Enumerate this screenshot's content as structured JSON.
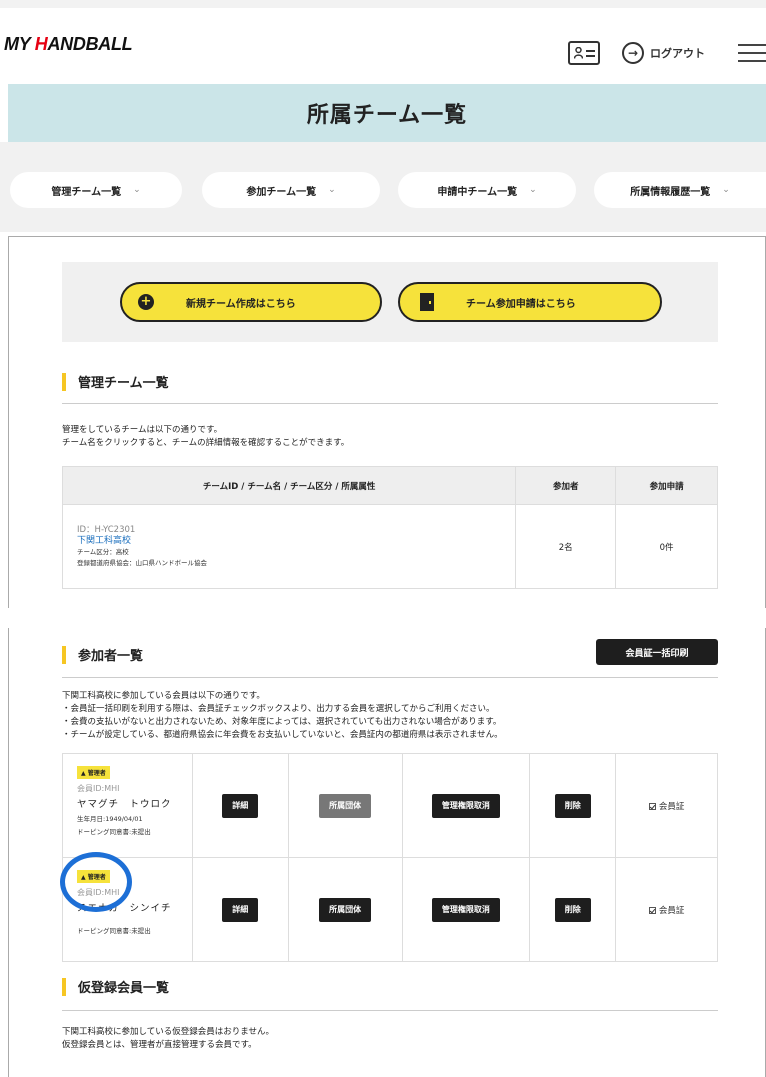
{
  "header": {
    "logo_prefix": "MY ",
    "logo_h": "H",
    "logo_rest": "ANDBALL",
    "logout_label": "ログアウト",
    "logout_arrow": "→"
  },
  "page_title": "所属チーム一覧",
  "tabs": [
    {
      "label": "管理チーム一覧",
      "chevron": "⌄"
    },
    {
      "label": "参加チーム一覧",
      "chevron": "⌄"
    },
    {
      "label": "申請中チーム一覧",
      "chevron": "⌄"
    },
    {
      "label": "所属情報履歴一覧",
      "chevron": "⌄"
    }
  ],
  "actions": {
    "create_team": "新規チーム作成はこちら",
    "create_icon": "+",
    "join_team": "チーム参加申請はこちら"
  },
  "managed": {
    "heading": "管理チーム一覧",
    "desc1": "管理をしているチームは以下の通りです。",
    "desc2": "チーム名をクリックすると、チームの詳細情報を確認することができます。",
    "col_team": "チームID / チーム名 / チーム区分 / 所属属性",
    "col_members": "参加者",
    "col_requests": "参加申請",
    "row": {
      "id": "ID：H-YC2301",
      "name": "下関工科高校",
      "category": "チーム区分：高校",
      "association": "登録都道府県協会：山口県ハンドボール協会",
      "members": "2名",
      "requests": "0件"
    }
  },
  "participants": {
    "heading": "参加者一覧",
    "print_btn": "会員証一括印刷",
    "desc1": "下関工科高校に参加している会員は以下の通りです。",
    "desc2": "・会員証一括印刷を利用する際は、会員証チェックボックスより、出力する会員を選択してからご利用ください。",
    "desc3": "・会費の支払いがないと出力されないため、対象年度によっては、選択されていても出力されない場合があります。",
    "desc4": "・チームが設定している、都道府県協会に年会費をお支払いしていないと、会員証内の都道府県は表示されません。",
    "members": [
      {
        "badge": "管理者",
        "id": "会員ID:MHI",
        "name": "ヤマグチ　トウロク",
        "birth": "生年月日:1949/04/01",
        "doping": "ドーピング同意書:未提出",
        "btn_detail": "詳細",
        "btn_group": "所属団体",
        "btn_admin": "管理権限取消",
        "btn_delete": "削除",
        "card_label": "会員証"
      },
      {
        "badge": "管理者",
        "id": "会員ID:MHI",
        "name": "スエナガ　シンイチ",
        "birth": "",
        "doping": "ドーピング同意書:未提出",
        "btn_detail": "詳細",
        "btn_group": "所属団体",
        "btn_admin": "管理権限取消",
        "btn_delete": "削除",
        "card_label": "会員証"
      }
    ]
  },
  "provisional": {
    "heading": "仮登録会員一覧",
    "desc1": "下関工科高校に参加している仮登録会員はおりません。",
    "desc2": "仮登録会員とは、管理者が直接管理する会員です。"
  },
  "colors": {
    "accent_yellow": "#f6e23b",
    "title_band": "#cbe5e8",
    "link_blue": "#1a6ebd",
    "highlight_circle": "#1d6fd6"
  }
}
